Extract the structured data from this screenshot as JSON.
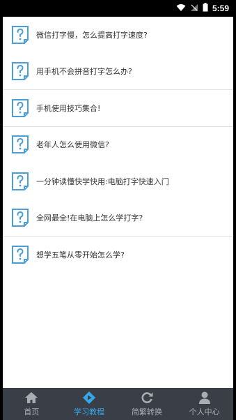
{
  "status": {
    "time": "5:59"
  },
  "articles": [
    {
      "title": "微信打字慢，怎么提高打字速度?"
    },
    {
      "title": "用手机不会拼音打字怎么办?"
    },
    {
      "title": "手机使用技巧集合!"
    },
    {
      "title": "老年人怎么使用微信?"
    },
    {
      "title": "一分钟读懂快学快用:电脑打字快速入门"
    },
    {
      "title": "全网最全!在电脑上怎么学打字?"
    },
    {
      "title": "想学五笔从零开始怎么学?"
    }
  ],
  "tabs": [
    {
      "label": "首页",
      "icon": "home-icon"
    },
    {
      "label": "学习教程",
      "icon": "tutorial-icon",
      "active": true
    },
    {
      "label": "简繁转换",
      "icon": "refresh-icon"
    },
    {
      "label": "个人中心",
      "icon": "person-icon"
    }
  ],
  "colors": {
    "accent": "#35a6e8",
    "tabbar": "#3a3f47",
    "icon_blue": "#4a9fd8"
  }
}
